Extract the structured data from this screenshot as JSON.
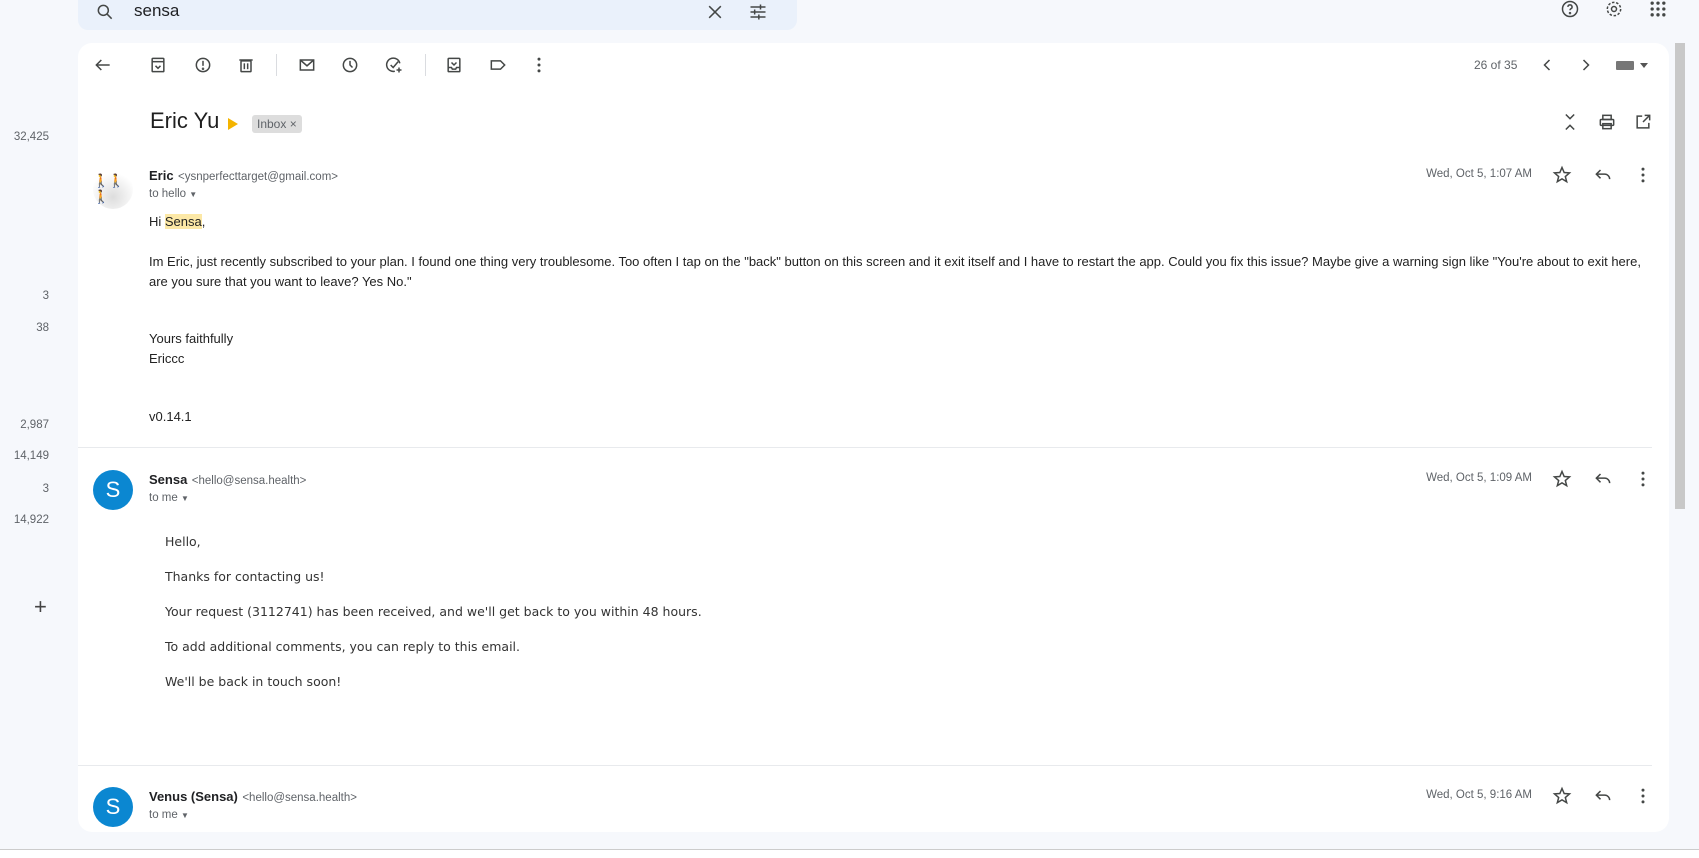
{
  "search": {
    "query": "sensa"
  },
  "sidebar": {
    "counts": [
      "32,425",
      "3",
      "38",
      "2,987",
      "14,149",
      "3",
      "14,922"
    ],
    "add_label": "+"
  },
  "toolbar": {
    "pagination": "26 of 35"
  },
  "thread": {
    "subject": "Eric Yu",
    "label": "Inbox",
    "label_remove": "×"
  },
  "messages": [
    {
      "sender": "Eric",
      "email": "<ysnperfecttarget@gmail.com>",
      "to": "to hello",
      "date": "Wed, Oct 5, 1:07 AM",
      "greeting_prefix": "Hi ",
      "greeting_highlight": "Sensa",
      "greeting_suffix": ",",
      "paragraph_line1": "Im Eric, just recently subscribed to your plan. I found one thing very troublesome. Too often I tap on the \"back\" button on this screen and it exit itself and I have to restart the app. Could you fix this issue? Maybe give a warning sign like \"You're about to exit here,",
      "paragraph_line2": "are you sure that you want to leave? Yes No.\"",
      "signoff": "Yours faithfully",
      "signature": "Ericcc",
      "version": "v0.14.1"
    },
    {
      "sender": "Sensa",
      "email": "<hello@sensa.health>",
      "to": "to me",
      "date": "Wed, Oct 5, 1:09 AM",
      "avatar_letter": "S",
      "lines": [
        "Hello,",
        "Thanks for contacting us!",
        "Your request (3112741) has been received, and we'll get back to you within 48 hours.",
        "To add additional comments, you can reply to this email.",
        "We'll be back in touch soon!"
      ]
    },
    {
      "sender": "Venus (Sensa)",
      "email": "<hello@sensa.health>",
      "to": "to me",
      "date": "Wed, Oct 5, 9:16 AM",
      "avatar_letter": "S"
    }
  ],
  "colors": {
    "avatar": "#0b87d1",
    "highlight": "#fce8a6",
    "importance": "#f4b400"
  }
}
